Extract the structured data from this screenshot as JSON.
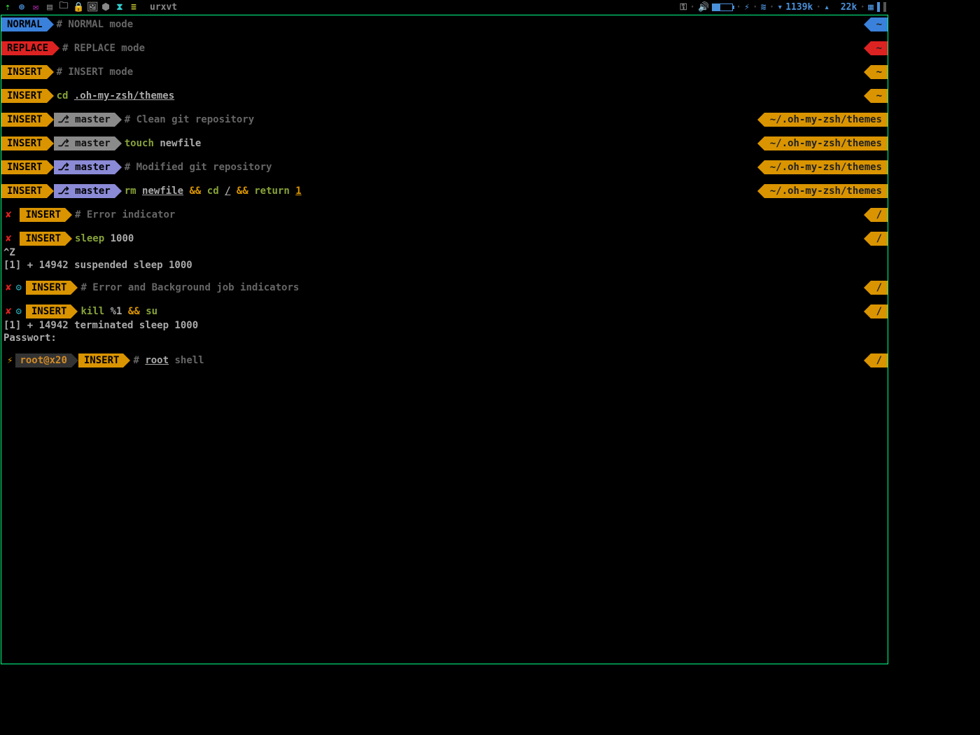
{
  "taskbar": {
    "app": "urxvt",
    "net_down": "1139k",
    "net_up": "22k"
  },
  "modes": {
    "normal": "NORMAL",
    "replace": "REPLACE",
    "insert": "INSERT"
  },
  "branch": "master",
  "path": "~/.oh-my-zsh/themes",
  "root_user": "root@x20",
  "tilde": "~",
  "slash": "/",
  "lines": {
    "l1": "# NORMAL mode",
    "l2": "# REPLACE mode",
    "l3": "# INSERT mode",
    "l4_cmd": "cd ",
    "l4_path": ".oh-my-zsh/themes",
    "l5": "# Clean git repository",
    "l6_cmd": "touch",
    "l6_arg": " newfile",
    "l7": "# Modified git repository",
    "l8_a": "rm ",
    "l8_b": "newfile",
    "l8_c": " && ",
    "l8_d": "cd ",
    "l8_e": "/",
    "l8_f": " && ",
    "l8_g": "return ",
    "l8_h": "1",
    "l9": "# Error indicator",
    "l10_a": "sleep",
    "l10_b": " 1000",
    "ctrlz": "^Z",
    "susp": "[1]  + 14942 suspended  sleep 1000",
    "l11": "# Error and Background job indicators",
    "l12_a": "kill",
    "l12_b": " %1",
    "l12_c": " && ",
    "l12_d": "su",
    "term": "[1]  + 14942 terminated  sleep 1000",
    "pass": "Passwort:",
    "l13_a": "# ",
    "l13_b": "root",
    "l13_c": " shell"
  },
  "glyphs": {
    "branch": "⎇",
    "bolt": "⚡",
    "x": "✘",
    "gear": "⚙"
  }
}
